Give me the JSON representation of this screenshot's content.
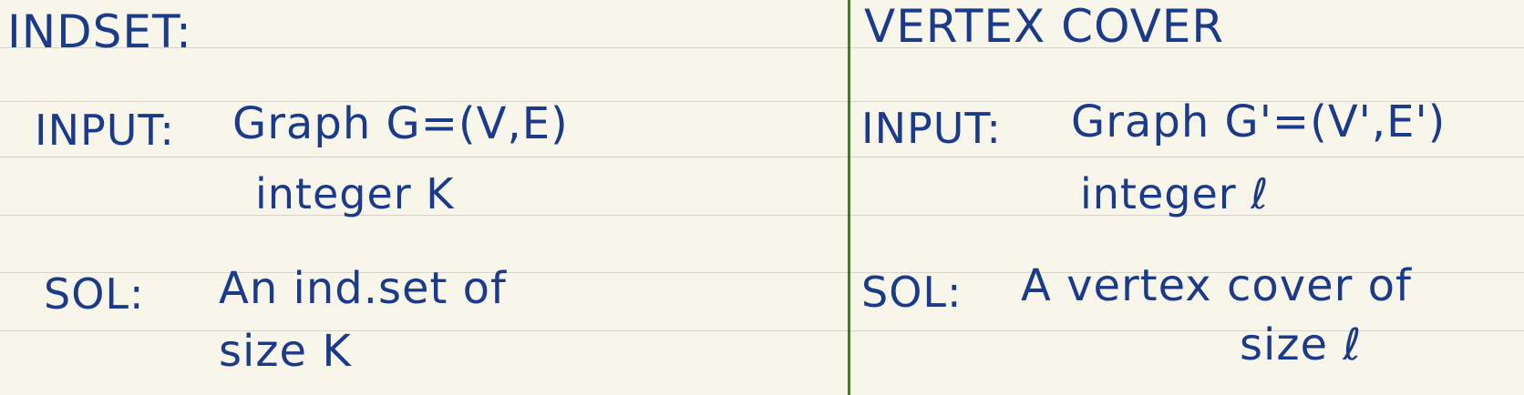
{
  "colors": {
    "paper": "#f8f5ea",
    "ink": "#1c3a8a",
    "rule": "#d7d4cc",
    "divider": "#3f7d2a"
  },
  "left": {
    "title": "INDSET:",
    "input_label": "INPUT:",
    "input_line1": "Graph G=(V,E)",
    "input_line2": "integer K",
    "sol_label": "SOL:",
    "sol_line1": "An ind.set of",
    "sol_line2": "size K"
  },
  "right": {
    "title": "VERTEX COVER",
    "input_label": "INPUT:",
    "input_line1": "Graph G'=(V',E')",
    "input_line2": "integer ℓ",
    "sol_label": "SOL:",
    "sol_line1": "A vertex cover of",
    "sol_line2": "size ℓ"
  }
}
